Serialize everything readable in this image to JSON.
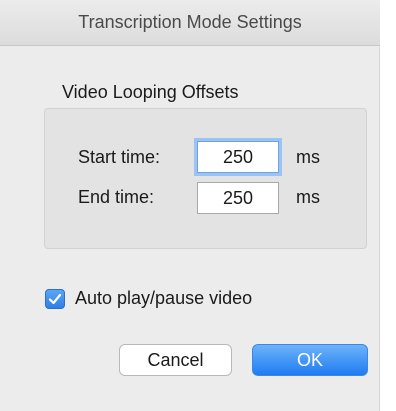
{
  "window": {
    "title": "Transcription Mode Settings"
  },
  "looping": {
    "group_title": "Video Looping Offsets",
    "start_label": "Start time:",
    "start_value": "250",
    "end_label": "End time:",
    "end_value": "250",
    "unit": "ms"
  },
  "autoplay": {
    "label": "Auto play/pause video",
    "checked": true
  },
  "buttons": {
    "cancel_label": "Cancel",
    "ok_label": "OK"
  },
  "colors": {
    "accent": "#2f7fe6",
    "focus_ring": "#9cc3f2"
  }
}
